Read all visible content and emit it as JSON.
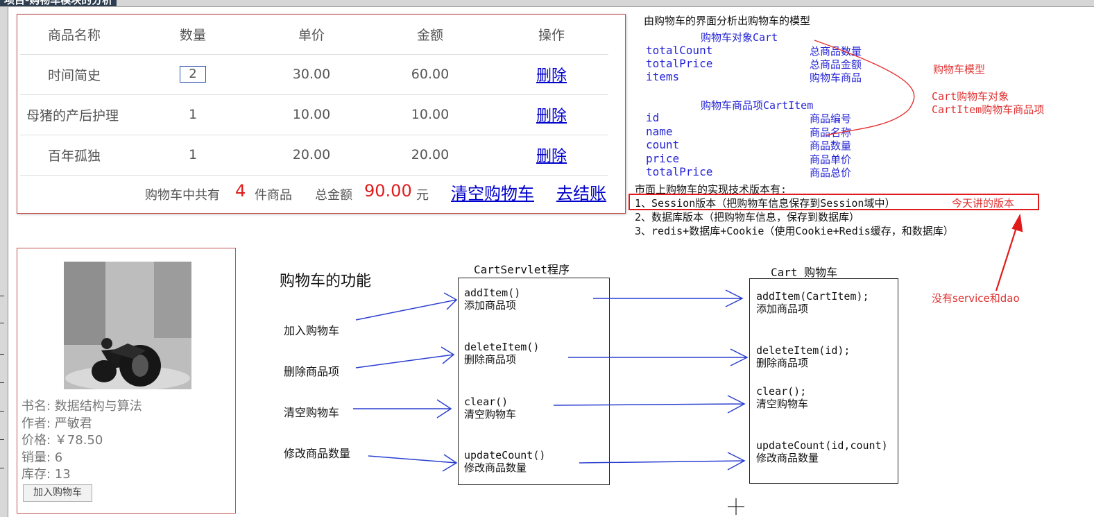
{
  "window": {
    "title": "项目-购物车模块的分析"
  },
  "cart": {
    "headers": [
      "商品名称",
      "数量",
      "单价",
      "金额",
      "操作"
    ],
    "rows": [
      {
        "name": "时间简史",
        "qty": "2",
        "price": "30.00",
        "amount": "60.00",
        "action": "删除"
      },
      {
        "name": "母猪的产后护理",
        "qty": "1",
        "price": "10.00",
        "amount": "10.00",
        "action": "删除"
      },
      {
        "name": "百年孤独",
        "qty": "1",
        "price": "20.00",
        "amount": "20.00",
        "action": "删除"
      }
    ],
    "footer": {
      "count_prefix": "购物车中共有",
      "count": "4",
      "count_suffix": "件商品",
      "total_label": "总金额",
      "total": "90.00",
      "total_unit": "元",
      "clear_link": "清空购物车",
      "checkout_link": "去结账"
    }
  },
  "book": {
    "name_line": "书名: 数据结构与算法",
    "author_line": "作者: 严敏君",
    "price_line": "价格: ￥78.50",
    "sales_line": "销量: 6",
    "stock_line": "库存: 13",
    "add_button": "加入购物车"
  },
  "model": {
    "heading": "由购物车的界面分析出购物车的模型",
    "cart_title": "购物车对象Cart",
    "cart_fields": [
      {
        "field": "totalCount",
        "desc": "总商品数量"
      },
      {
        "field": "totalPrice",
        "desc": "总商品金额"
      },
      {
        "field": "items",
        "desc": "购物车商品"
      }
    ],
    "item_title": "购物车商品项CartItem",
    "item_fields": [
      {
        "field": "id",
        "desc": "商品编号"
      },
      {
        "field": "name",
        "desc": "商品名称"
      },
      {
        "field": "count",
        "desc": "商品数量"
      },
      {
        "field": "price",
        "desc": "商品单价"
      },
      {
        "field": "totalPrice",
        "desc": "商品总价"
      }
    ],
    "annotation_title": "购物车模型",
    "annotation_line1": "Cart购物车对象",
    "annotation_line2": "CartItem购物车商品项",
    "versions_title": "市面上购物车的实现技术版本有:",
    "version1": "1、Session版本（把购物车信息保存到Session域中）",
    "version1_note": "今天讲的版本",
    "version2": "2、数据库版本（把购物车信息，保存到数据库）",
    "version3": "3、redis+数据库+Cookie（使用Cookie+Redis缓存，和数据库）",
    "no_service_note": "没有service和dao"
  },
  "diagram": {
    "features_title": "购物车的功能",
    "features": [
      "加入购物车",
      "删除商品项",
      "清空购物车",
      "修改商品数量"
    ],
    "servlet_title": "CartServlet程序",
    "servlet_methods": [
      {
        "sig": "addItem()",
        "desc": "添加商品项"
      },
      {
        "sig": "deleteItem()",
        "desc": "删除商品项"
      },
      {
        "sig": "clear()",
        "desc": "清空购物车"
      },
      {
        "sig": "updateCount()",
        "desc": "修改商品数量"
      }
    ],
    "cart_title": "Cart 购物车",
    "cart_methods": [
      {
        "sig": "addItem(CartItem);",
        "desc": "添加商品项"
      },
      {
        "sig": "deleteItem(id);",
        "desc": "删除商品项"
      },
      {
        "sig": "clear();",
        "desc": "清空购物车"
      },
      {
        "sig": "updateCount(id,count)",
        "desc": "修改商品数量"
      }
    ]
  },
  "colors": {
    "panel_border": "#c0504d",
    "link": "#0000cc",
    "note_blue": "#2424d6",
    "note_red": "#e03030",
    "arrow_blue": "#2a3fd0"
  }
}
